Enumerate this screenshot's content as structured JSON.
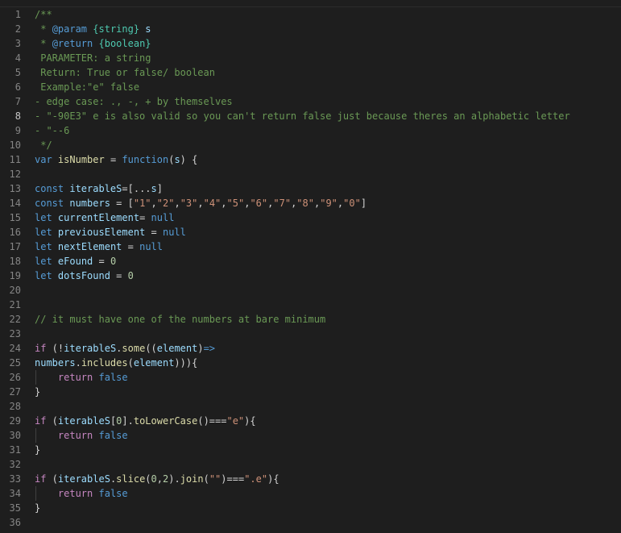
{
  "editor": {
    "theme_colors": {
      "background": "#1e1e1e",
      "line_number": "#858585",
      "active_line_number": "#c6c6c6",
      "comment": "#6a9955",
      "keyword": "#569cd6",
      "control": "#c586c0",
      "variable": "#9cdcfe",
      "function": "#dcdcaa",
      "string": "#ce9178",
      "number": "#b5cea8",
      "type": "#4ec9b0",
      "text": "#d4d4d4"
    },
    "active_line": 8,
    "lines": [
      {
        "n": "1",
        "segs": [
          [
            "comment",
            "/**"
          ]
        ]
      },
      {
        "n": "2",
        "segs": [
          [
            "comment",
            " * "
          ],
          [
            "doctag",
            "@param"
          ],
          [
            "comment",
            " "
          ],
          [
            "doctype",
            "{string}"
          ],
          [
            "var",
            " s"
          ]
        ]
      },
      {
        "n": "3",
        "segs": [
          [
            "comment",
            " * "
          ],
          [
            "doctag",
            "@return"
          ],
          [
            "comment",
            " "
          ],
          [
            "doctype",
            "{boolean}"
          ]
        ]
      },
      {
        "n": "4",
        "segs": [
          [
            "comment",
            " PARAMETER: a string"
          ]
        ]
      },
      {
        "n": "5",
        "segs": [
          [
            "comment",
            " Return: True or false/ boolean"
          ]
        ]
      },
      {
        "n": "6",
        "segs": [
          [
            "comment",
            " Example:\"e\" false"
          ]
        ]
      },
      {
        "n": "7",
        "segs": [
          [
            "comment",
            "- edge case: ., -, + by themselves"
          ]
        ]
      },
      {
        "n": "8",
        "segs": [
          [
            "comment",
            "- \"-90E3\" e is also valid so you can't return false just because theres an alphabetic letter"
          ]
        ]
      },
      {
        "n": "9",
        "segs": [
          [
            "comment",
            "- \"--6"
          ]
        ]
      },
      {
        "n": "10",
        "segs": [
          [
            "comment",
            " */"
          ]
        ]
      },
      {
        "n": "11",
        "segs": [
          [
            "kw",
            "var"
          ],
          [
            "op",
            " "
          ],
          [
            "fn",
            "isNumber"
          ],
          [
            "op",
            " = "
          ],
          [
            "kw",
            "function"
          ],
          [
            "op",
            "("
          ],
          [
            "var",
            "s"
          ],
          [
            "op",
            ") {"
          ]
        ]
      },
      {
        "n": "12",
        "segs": []
      },
      {
        "n": "13",
        "segs": [
          [
            "kw",
            "const"
          ],
          [
            "op",
            " "
          ],
          [
            "var",
            "iterableS"
          ],
          [
            "op",
            "=[..."
          ],
          [
            "var",
            "s"
          ],
          [
            "op",
            "]"
          ]
        ]
      },
      {
        "n": "14",
        "segs": [
          [
            "kw",
            "const"
          ],
          [
            "op",
            " "
          ],
          [
            "var",
            "numbers"
          ],
          [
            "op",
            " = ["
          ],
          [
            "str",
            "\"1\""
          ],
          [
            "op",
            ","
          ],
          [
            "str",
            "\"2\""
          ],
          [
            "op",
            ","
          ],
          [
            "str",
            "\"3\""
          ],
          [
            "op",
            ","
          ],
          [
            "str",
            "\"4\""
          ],
          [
            "op",
            ","
          ],
          [
            "str",
            "\"5\""
          ],
          [
            "op",
            ","
          ],
          [
            "str",
            "\"6\""
          ],
          [
            "op",
            ","
          ],
          [
            "str",
            "\"7\""
          ],
          [
            "op",
            ","
          ],
          [
            "str",
            "\"8\""
          ],
          [
            "op",
            ","
          ],
          [
            "str",
            "\"9\""
          ],
          [
            "op",
            ","
          ],
          [
            "str",
            "\"0\""
          ],
          [
            "op",
            "]"
          ]
        ]
      },
      {
        "n": "15",
        "segs": [
          [
            "kw",
            "let"
          ],
          [
            "op",
            " "
          ],
          [
            "var",
            "currentElement"
          ],
          [
            "op",
            "= "
          ],
          [
            "kw",
            "null"
          ]
        ]
      },
      {
        "n": "16",
        "segs": [
          [
            "kw",
            "let"
          ],
          [
            "op",
            " "
          ],
          [
            "var",
            "previousElement"
          ],
          [
            "op",
            " = "
          ],
          [
            "kw",
            "null"
          ]
        ]
      },
      {
        "n": "17",
        "segs": [
          [
            "kw",
            "let"
          ],
          [
            "op",
            " "
          ],
          [
            "var",
            "nextElement"
          ],
          [
            "op",
            " = "
          ],
          [
            "kw",
            "null"
          ]
        ]
      },
      {
        "n": "18",
        "segs": [
          [
            "kw",
            "let"
          ],
          [
            "op",
            " "
          ],
          [
            "var",
            "eFound"
          ],
          [
            "op",
            " = "
          ],
          [
            "num",
            "0"
          ]
        ]
      },
      {
        "n": "19",
        "segs": [
          [
            "kw",
            "let"
          ],
          [
            "op",
            " "
          ],
          [
            "var",
            "dotsFound"
          ],
          [
            "op",
            " = "
          ],
          [
            "num",
            "0"
          ]
        ]
      },
      {
        "n": "20",
        "segs": []
      },
      {
        "n": "21",
        "segs": []
      },
      {
        "n": "22",
        "segs": [
          [
            "comment",
            "// it must have one of the numbers at bare minimum"
          ]
        ]
      },
      {
        "n": "23",
        "segs": []
      },
      {
        "n": "24",
        "segs": [
          [
            "ctrl",
            "if"
          ],
          [
            "op",
            " (!"
          ],
          [
            "var",
            "iterableS"
          ],
          [
            "op",
            "."
          ],
          [
            "fn",
            "some"
          ],
          [
            "op",
            "(("
          ],
          [
            "var",
            "element"
          ],
          [
            "op",
            ")"
          ],
          [
            "kw",
            "=>"
          ]
        ]
      },
      {
        "n": "25",
        "segs": [
          [
            "var",
            "numbers"
          ],
          [
            "op",
            "."
          ],
          [
            "fn",
            "includes"
          ],
          [
            "op",
            "("
          ],
          [
            "var",
            "element"
          ],
          [
            "op",
            "))){"
          ]
        ]
      },
      {
        "n": "26",
        "guide": true,
        "segs": [
          [
            "op",
            "    "
          ],
          [
            "ctrl",
            "return"
          ],
          [
            "op",
            " "
          ],
          [
            "kw",
            "false"
          ]
        ]
      },
      {
        "n": "27",
        "segs": [
          [
            "op",
            "}"
          ]
        ]
      },
      {
        "n": "28",
        "segs": []
      },
      {
        "n": "29",
        "segs": [
          [
            "ctrl",
            "if"
          ],
          [
            "op",
            " ("
          ],
          [
            "var",
            "iterableS"
          ],
          [
            "op",
            "["
          ],
          [
            "num",
            "0"
          ],
          [
            "op",
            "]."
          ],
          [
            "fn",
            "toLowerCase"
          ],
          [
            "op",
            "()==="
          ],
          [
            "str",
            "\"e\""
          ],
          [
            "op",
            "){"
          ]
        ]
      },
      {
        "n": "30",
        "guide": true,
        "segs": [
          [
            "op",
            "    "
          ],
          [
            "ctrl",
            "return"
          ],
          [
            "op",
            " "
          ],
          [
            "kw",
            "false"
          ]
        ]
      },
      {
        "n": "31",
        "segs": [
          [
            "op",
            "}"
          ]
        ]
      },
      {
        "n": "32",
        "segs": []
      },
      {
        "n": "33",
        "segs": [
          [
            "ctrl",
            "if"
          ],
          [
            "op",
            " ("
          ],
          [
            "var",
            "iterableS"
          ],
          [
            "op",
            "."
          ],
          [
            "fn",
            "slice"
          ],
          [
            "op",
            "("
          ],
          [
            "num",
            "0"
          ],
          [
            "op",
            ","
          ],
          [
            "num",
            "2"
          ],
          [
            "op",
            ")."
          ],
          [
            "fn",
            "join"
          ],
          [
            "op",
            "("
          ],
          [
            "str",
            "\"\""
          ],
          [
            "op",
            ")==="
          ],
          [
            "str",
            "\".e\""
          ],
          [
            "op",
            "){"
          ]
        ]
      },
      {
        "n": "34",
        "guide": true,
        "segs": [
          [
            "op",
            "    "
          ],
          [
            "ctrl",
            "return"
          ],
          [
            "op",
            " "
          ],
          [
            "kw",
            "false"
          ]
        ]
      },
      {
        "n": "35",
        "segs": [
          [
            "op",
            "}"
          ]
        ]
      },
      {
        "n": "36",
        "segs": []
      }
    ]
  }
}
